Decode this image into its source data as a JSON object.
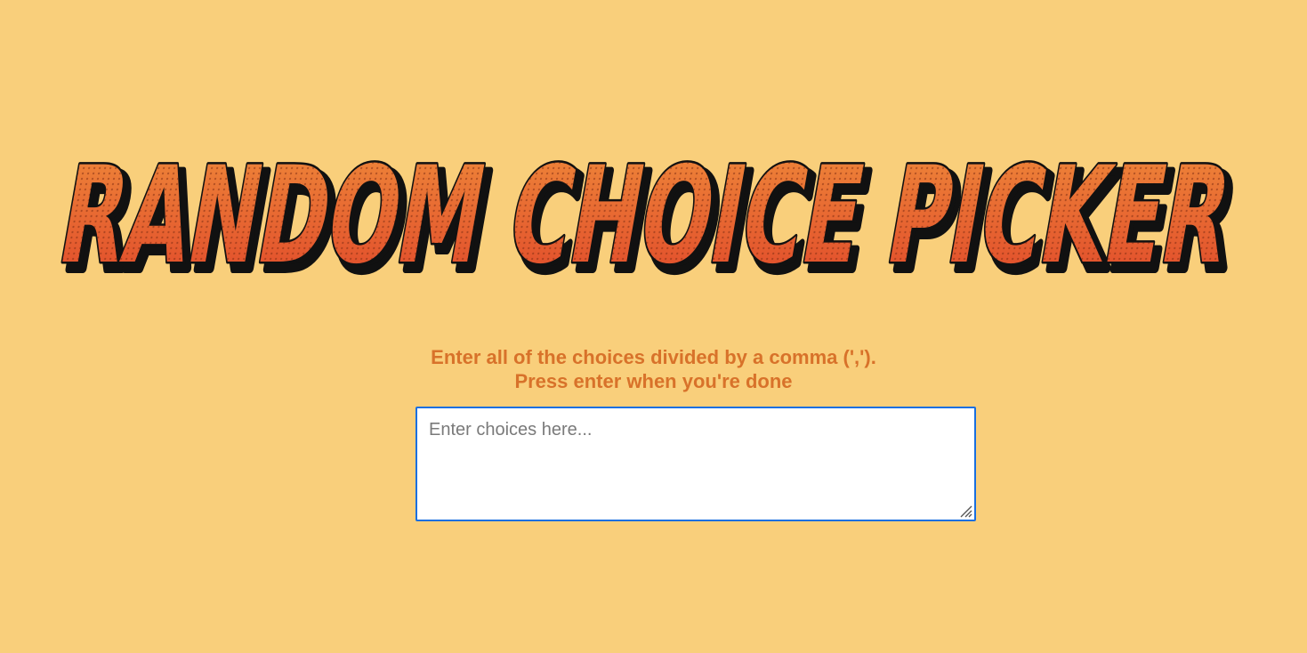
{
  "page": {
    "title_logo_text": "RANDOM CHOICE PICKER",
    "instructions_line1": "Enter all of the choices divided by a comma (',').",
    "instructions_line2": "Press enter when you're done",
    "choices_input": {
      "placeholder": "Enter choices here...",
      "value": ""
    },
    "colors": {
      "background": "#f9cf7b",
      "logo_fill_top": "#ef8a3a",
      "logo_fill_bottom": "#e0472a",
      "logo_outline": "#111111",
      "instructions_text": "#d8722a",
      "input_border_focus": "#1a6fe0"
    },
    "icons": {
      "resize_grip": "resize-grip-icon"
    }
  }
}
